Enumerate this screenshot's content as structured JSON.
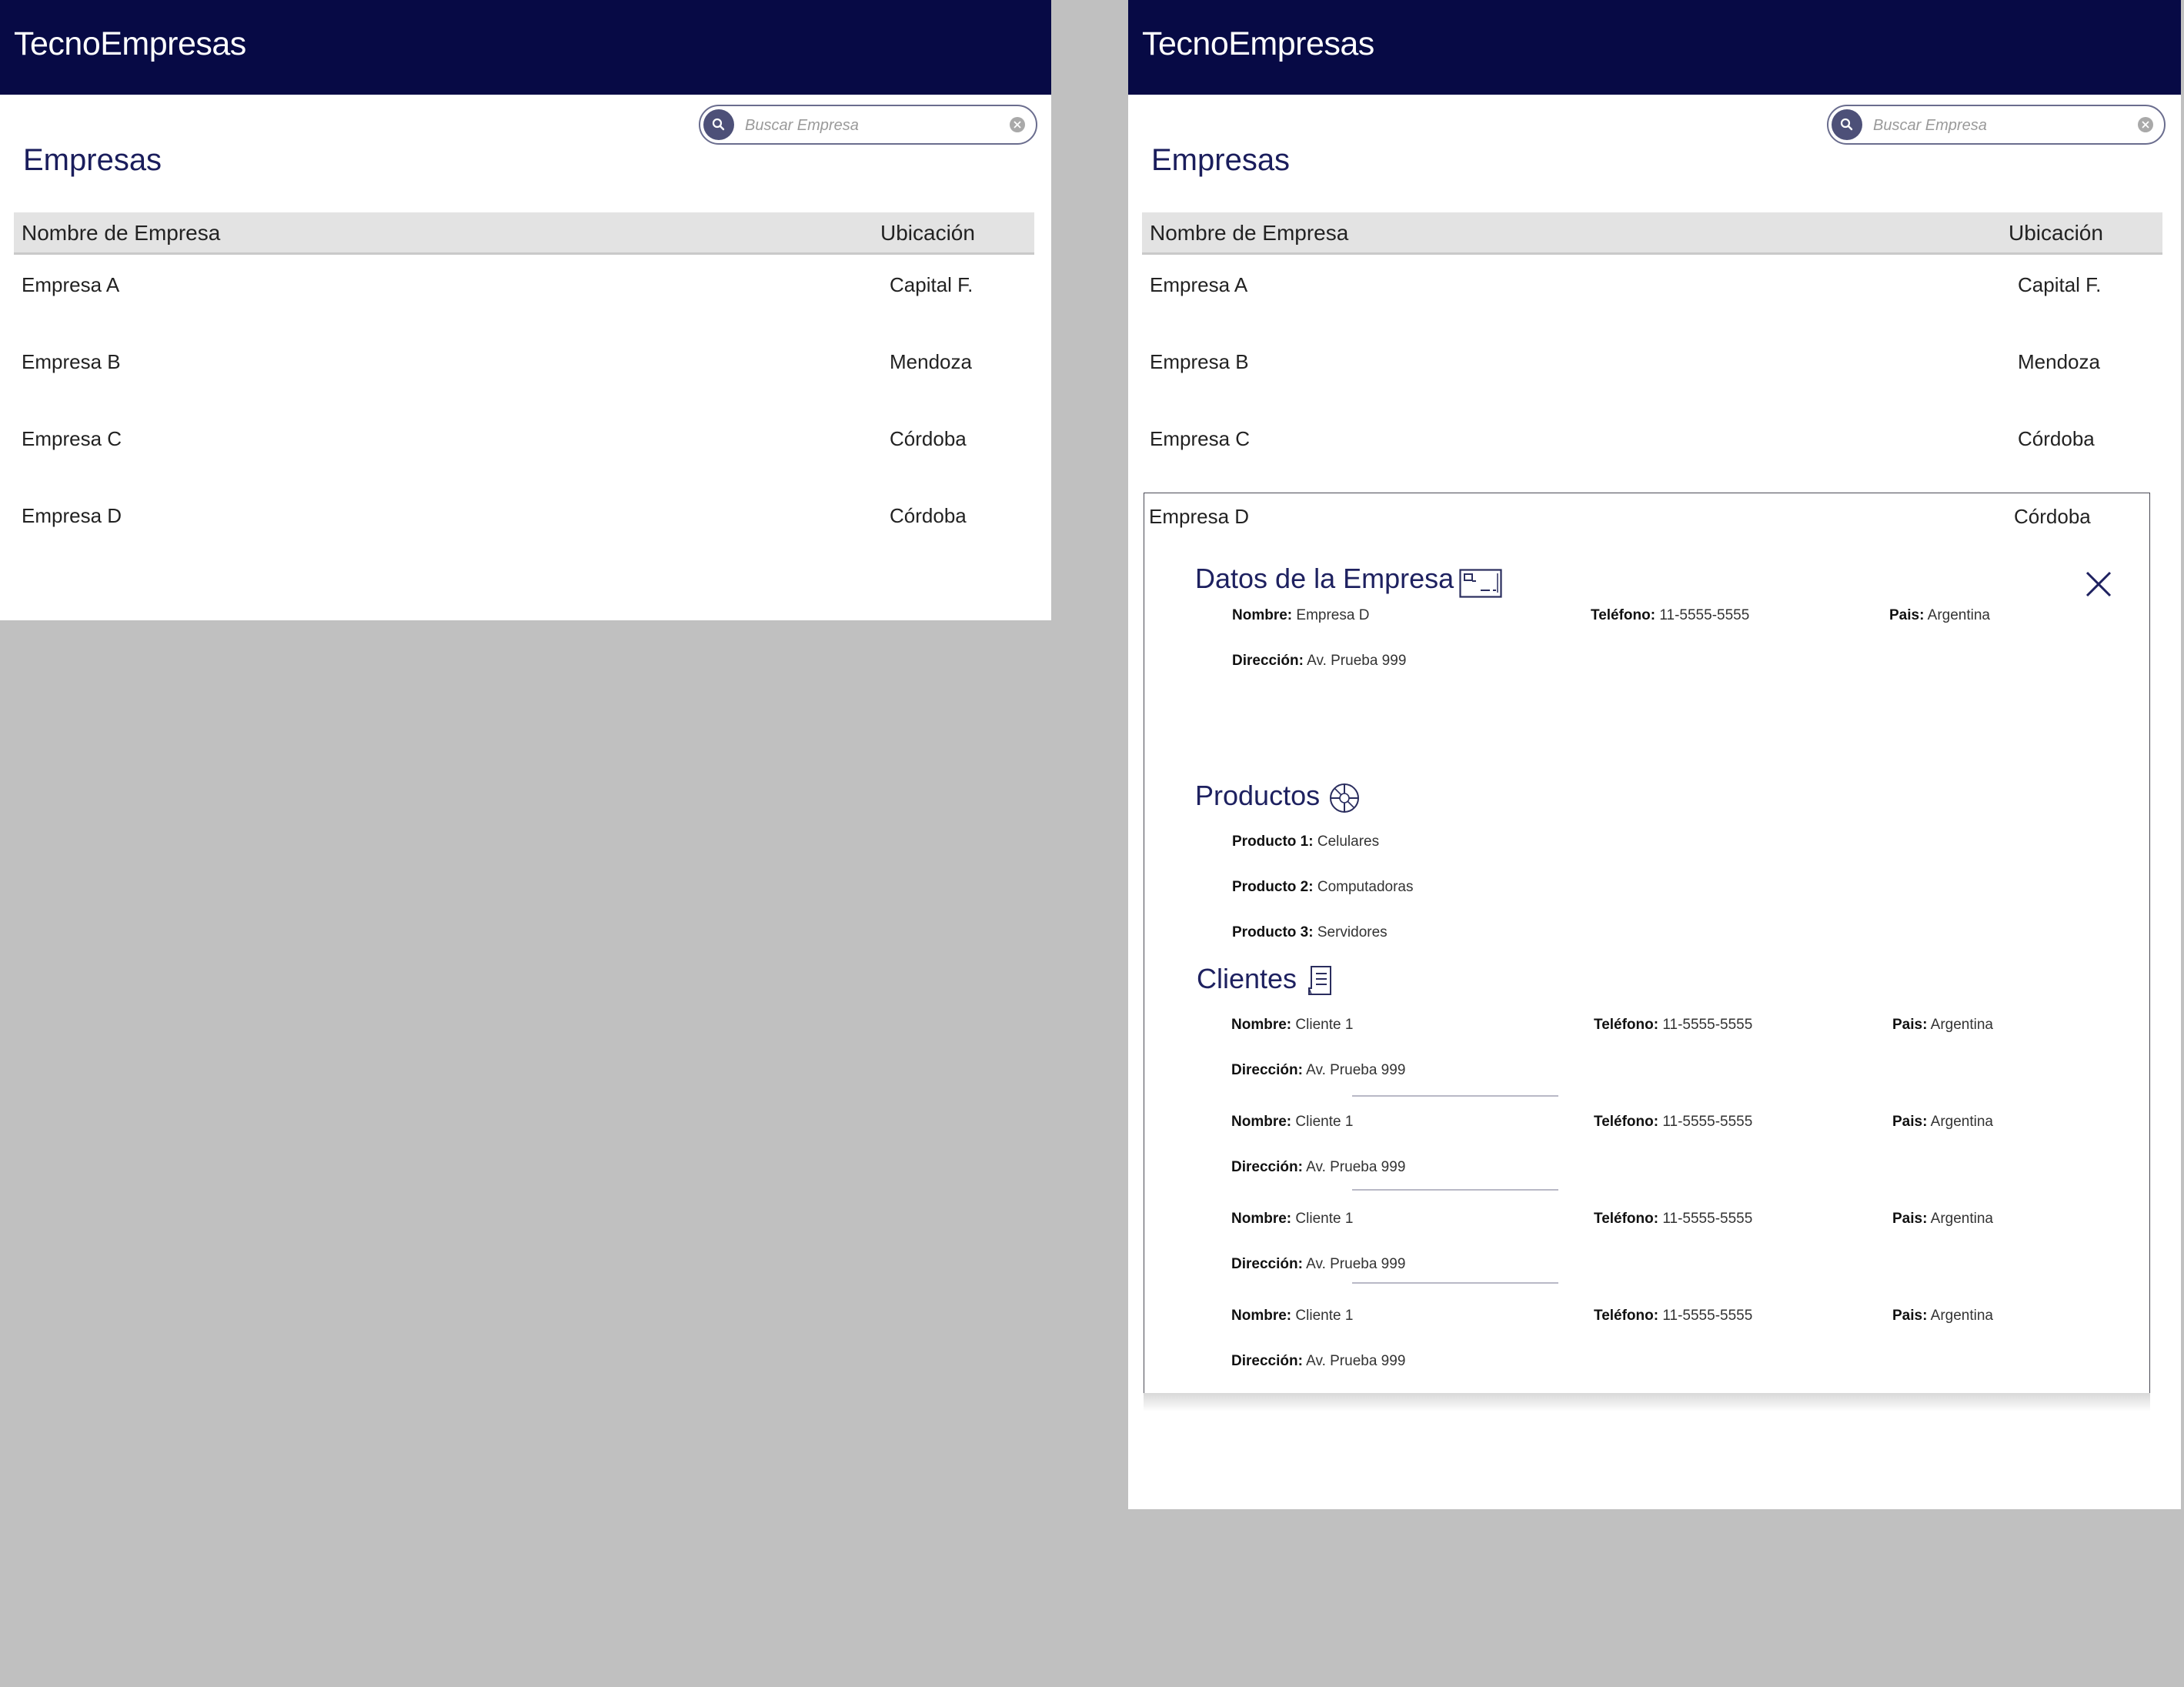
{
  "app": {
    "title": "TecnoEmpresas"
  },
  "search": {
    "placeholder": "Buscar Empresa"
  },
  "page": {
    "title": "Empresas"
  },
  "table": {
    "headers": {
      "name": "Nombre de Empresa",
      "location": "Ubicación"
    },
    "rows": [
      {
        "name": "Empresa A",
        "location": "Capital F."
      },
      {
        "name": "Empresa B",
        "location": "Mendoza"
      },
      {
        "name": "Empresa C",
        "location": "Córdoba"
      },
      {
        "name": "Empresa D",
        "location": "Córdoba"
      }
    ]
  },
  "detail": {
    "company_section": {
      "title": "Datos de la Empresa",
      "icon": "id-card-icon",
      "name_label": "Nombre:",
      "name": "Empresa D",
      "phone_label": "Teléfono:",
      "phone": "11-5555-5555",
      "country_label": "Pais:",
      "country": "Argentina",
      "address_label": "Dirección:",
      "address": "Av. Prueba 999"
    },
    "products_section": {
      "title": "Productos",
      "icon": "pie-chart-icon",
      "items": [
        {
          "label": "Producto 1:",
          "value": "Celulares"
        },
        {
          "label": "Producto 2:",
          "value": "Computadoras"
        },
        {
          "label": "Producto 3:",
          "value": "Servidores"
        }
      ]
    },
    "clients_section": {
      "title": "Clientes",
      "icon": "document-icon",
      "labels": {
        "name": "Nombre:",
        "phone": "Teléfono:",
        "country": "Pais:",
        "address": "Dirección:"
      },
      "items": [
        {
          "name": "Cliente 1",
          "phone": "11-5555-5555",
          "country": "Argentina",
          "address": "Av. Prueba 999"
        },
        {
          "name": "Cliente 1",
          "phone": "11-5555-5555",
          "country": "Argentina",
          "address": "Av. Prueba 999"
        },
        {
          "name": "Cliente 1",
          "phone": "11-5555-5555",
          "country": "Argentina",
          "address": "Av. Prueba 999"
        },
        {
          "name": "Cliente 1",
          "phone": "11-5555-5555",
          "country": "Argentina",
          "address": "Av. Prueba 999"
        }
      ]
    }
  },
  "colors": {
    "header": "#070a45",
    "accent": "#1e2160",
    "table_header": "#e3e3e3",
    "background": "#c0c0c0"
  }
}
